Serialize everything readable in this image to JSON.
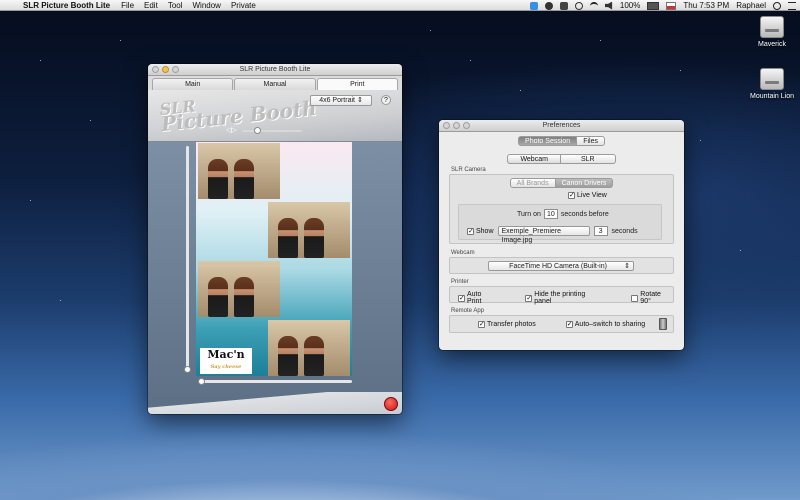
{
  "menubar": {
    "app_name": "SLR Picture Booth Lite",
    "items": [
      "File",
      "Edit",
      "Tool",
      "Window",
      "Private"
    ],
    "battery": "100%",
    "clock": "Thu 7:53 PM",
    "user": "Raphael"
  },
  "desktop": {
    "icons": [
      {
        "label": "Maverick"
      },
      {
        "label": "Mountain Lion"
      }
    ]
  },
  "slr_window": {
    "title": "SLR Picture Booth Lite",
    "tabs": [
      "Main",
      "Manual",
      "Print"
    ],
    "active_tab": "Print",
    "logo_line1": "SLR",
    "logo_line2": "Picture Booth",
    "format": "4x6 Portrait",
    "help": "?",
    "zoom_glyph": "◁▷",
    "maclogo_text": "Mac'n",
    "maclogo_sub": "Say cheese"
  },
  "preferences": {
    "title": "Preferences",
    "top_tabs": [
      "Photo Session",
      "Files"
    ],
    "active_top_tab": "Photo Session",
    "source_tabs": [
      "Webcam",
      "SLR"
    ],
    "active_source_tab": "Webcam",
    "slr_camera": {
      "label": "SLR Camera",
      "brand_tabs": [
        "All Brands",
        "Canon Drivers"
      ],
      "active_brand": "Canon Drivers",
      "live_view_label": "Live View",
      "turn_on_label": "Turn on",
      "turn_on_value": "10",
      "seconds_before_label": "seconds before",
      "show_label": "Show",
      "image_file": "Exemple_Premiere Image.jpg",
      "show_seconds_value": "3",
      "seconds_label": "seconds"
    },
    "webcam": {
      "label": "Webcam",
      "selected": "FaceTime HD Camera (Built-in)"
    },
    "printer": {
      "label": "Printer",
      "auto_print": "Auto Print",
      "hide_panel": "Hide the printing panel",
      "rotate": "Rotate 90°"
    },
    "remote": {
      "label": "Remote App",
      "transfer": "Transfer photos",
      "auto_switch": "Auto–switch to sharing"
    }
  }
}
